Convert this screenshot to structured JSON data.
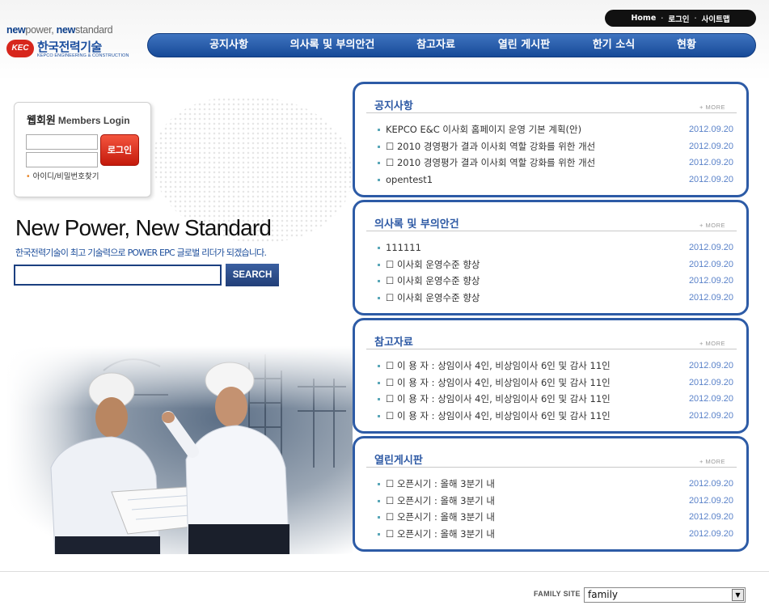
{
  "logo": {
    "slogan_new1": "new",
    "slogan_power": "power, ",
    "slogan_new2": "new",
    "slogan_standard": "standard",
    "mark": "KEC",
    "name": "한국전력기술",
    "sub": "KEPCO ENGINEERING & CONSTRUCTION"
  },
  "util_nav": {
    "home": "Home",
    "login": "로그인",
    "sitemap": "사이트맵",
    "separator": "·"
  },
  "gnb": [
    "공지사항",
    "의사록 및 부의안건",
    "참고자료",
    "열린 게시판",
    "한기 소식",
    "현황"
  ],
  "login": {
    "title_kr": "웹회원",
    "title_en": "Members Login",
    "id_value": "",
    "pw_value": "",
    "button": "로그인",
    "find_bullet": "•",
    "find_link": "아이디/비밀번호찾기"
  },
  "hero": {
    "headline": "New Power, New Standard",
    "subline": "한국전력기술이 최고 기술력으로 POWER EPC 글로벌 리더가 되겠습니다."
  },
  "search": {
    "value": "",
    "button": "SEARCH"
  },
  "boards": [
    {
      "title": "공지사항",
      "more": "+ MORE",
      "items": [
        {
          "subject": "KEPCO E&C 이사회 홈페이지 운영 기본 계획(안)",
          "date": "2012.09.20"
        },
        {
          "subject": "☐ 2010 경영평가 결과 이사회 역할 강화를 위한 개선",
          "date": "2012.09.20"
        },
        {
          "subject": "☐ 2010 경영평가 결과 이사회 역할 강화를 위한 개선",
          "date": "2012.09.20"
        },
        {
          "subject": "opentest1",
          "date": "2012.09.20"
        }
      ]
    },
    {
      "title": "의사록 및 부의안건",
      "more": "+ MORE",
      "items": [
        {
          "subject": "111111",
          "date": "2012.09.20"
        },
        {
          "subject": "☐ 이사회 운영수준 향상",
          "date": "2012.09.20"
        },
        {
          "subject": "☐ 이사회 운영수준 향상",
          "date": "2012.09.20"
        },
        {
          "subject": "☐ 이사회 운영수준 향상",
          "date": "2012.09.20"
        }
      ]
    },
    {
      "title": "참고자료",
      "more": "+ MORE",
      "items": [
        {
          "subject": "☐ 이 용 자 : 상임이사 4인, 비상임이사 6인 및 감사 11인",
          "date": "2012.09.20"
        },
        {
          "subject": "☐ 이 용 자 : 상임이사 4인, 비상임이사 6인 및 감사 11인",
          "date": "2012.09.20"
        },
        {
          "subject": "☐ 이 용 자 : 상임이사 4인, 비상임이사 6인 및 감사 11인",
          "date": "2012.09.20"
        },
        {
          "subject": "☐ 이 용 자 : 상임이사 4인, 비상임이사 6인 및 감사 11인",
          "date": "2012.09.20"
        }
      ]
    },
    {
      "title": "열린게시판",
      "more": "+ MORE",
      "items": [
        {
          "subject": "☐ 오픈시기 : 올해 3분기 내",
          "date": "2012.09.20"
        },
        {
          "subject": "☐ 오픈시기 : 올해 3분기 내",
          "date": "2012.09.20"
        },
        {
          "subject": "☐ 오픈시기 : 올해 3분기 내",
          "date": "2012.09.20"
        },
        {
          "subject": "☐ 오픈시기 : 올해 3분기 내",
          "date": "2012.09.20"
        }
      ]
    }
  ],
  "footer": {
    "family_label": "FAMILY SITE",
    "family_selected": "family",
    "select_arrow": "▼"
  },
  "colors": {
    "primary_blue": "#2d5ba6",
    "nav_blue": "#174a98",
    "login_red": "#d7261c",
    "date_blue": "#5a82c9"
  },
  "icons": {
    "board_bullet": "square-bullet-icon",
    "select_arrow": "chevron-down-icon"
  }
}
